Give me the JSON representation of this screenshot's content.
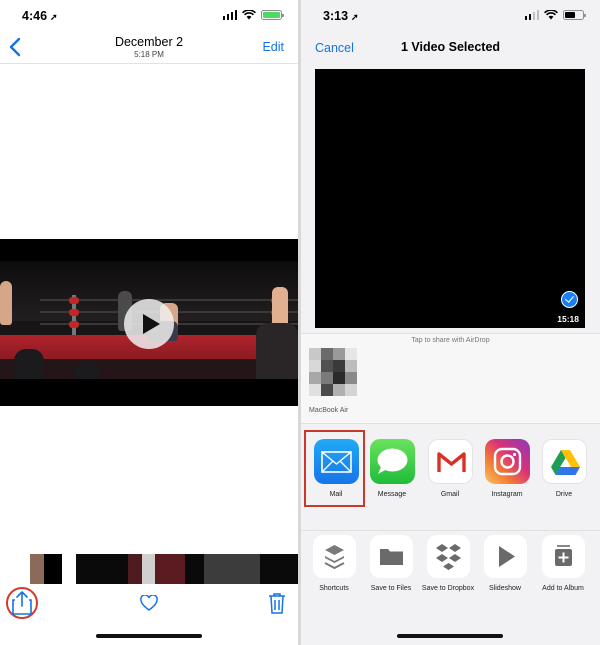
{
  "left": {
    "status": {
      "time": "4:46",
      "battery_color": "#4cd964"
    },
    "nav": {
      "title": "December 2",
      "subtitle": "5:18 PM",
      "edit_label": "Edit"
    },
    "video": {
      "has_play_button": true
    },
    "toolbar": {
      "share_icon": "share-icon",
      "favorite_icon": "heart-icon",
      "delete_icon": "trash-icon",
      "highlight_color": "#d33a2c"
    }
  },
  "right": {
    "status": {
      "time": "3:13",
      "battery_color": "#000000"
    },
    "header": {
      "cancel_label": "Cancel",
      "title": "1 Video Selected"
    },
    "preview": {
      "duration": "15:18",
      "selected": true
    },
    "airdrop": {
      "hint": "Tap to share with AirDrop",
      "device_name": "MacBook Air"
    },
    "apps": [
      {
        "label": "Mail",
        "icon": "mail-icon",
        "highlighted": true
      },
      {
        "label": "Message",
        "icon": "messages-icon"
      },
      {
        "label": "Gmail",
        "icon": "gmail-icon"
      },
      {
        "label": "Instagram",
        "icon": "instagram-icon"
      },
      {
        "label": "Drive",
        "icon": "google-drive-icon"
      }
    ],
    "actions": [
      {
        "label": "Shortcuts",
        "icon": "shortcuts-icon"
      },
      {
        "label": "Save to Files",
        "icon": "folder-icon"
      },
      {
        "label": "Save to Dropbox",
        "icon": "dropbox-icon"
      },
      {
        "label": "Slideshow",
        "icon": "play-icon"
      },
      {
        "label": "Add to Album",
        "icon": "add-album-icon"
      }
    ],
    "accent_color": "#1473e6",
    "highlight_color": "#c9382b"
  }
}
